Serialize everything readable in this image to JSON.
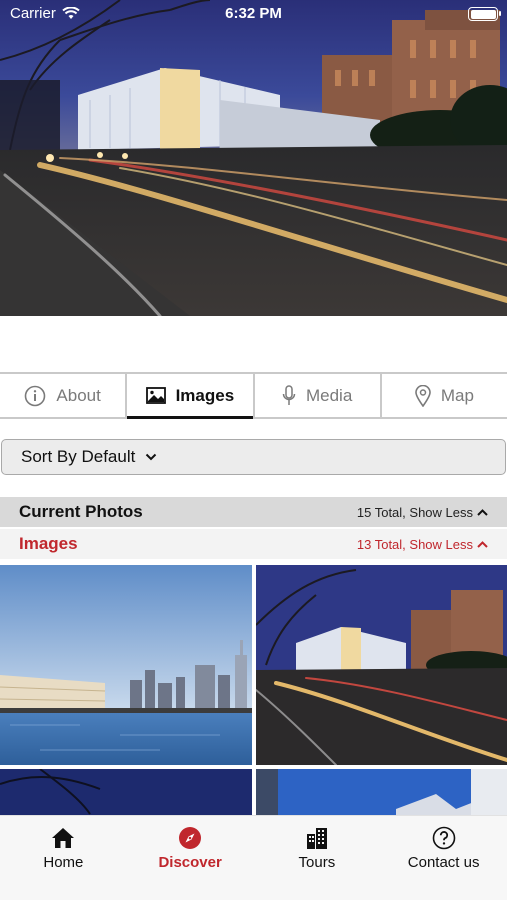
{
  "status_bar": {
    "carrier": "Carrier",
    "time": "6:32 PM"
  },
  "tabs": [
    {
      "label": "About",
      "icon": "info-icon",
      "active": false
    },
    {
      "label": "Images",
      "icon": "image-icon",
      "active": true
    },
    {
      "label": "Media",
      "icon": "microphone-icon",
      "active": false
    },
    {
      "label": "Map",
      "icon": "map-pin-icon",
      "active": false
    }
  ],
  "sort": {
    "label": "Sort By Default"
  },
  "sections": {
    "current": {
      "title": "Current Photos",
      "meta": "15 Total, Show Less"
    },
    "images": {
      "title": "Images",
      "meta": "13 Total, Show Less"
    }
  },
  "bottom_nav": [
    {
      "label": "Home",
      "icon": "home-icon",
      "active": false
    },
    {
      "label": "Discover",
      "icon": "compass-icon",
      "active": true
    },
    {
      "label": "Tours",
      "icon": "buildings-icon",
      "active": false
    },
    {
      "label": "Contact us",
      "icon": "help-circle-icon",
      "active": false
    }
  ],
  "colors": {
    "accent": "#c0272d",
    "tab_border": "#c9c9c9",
    "sort_bg": "#ececec"
  }
}
